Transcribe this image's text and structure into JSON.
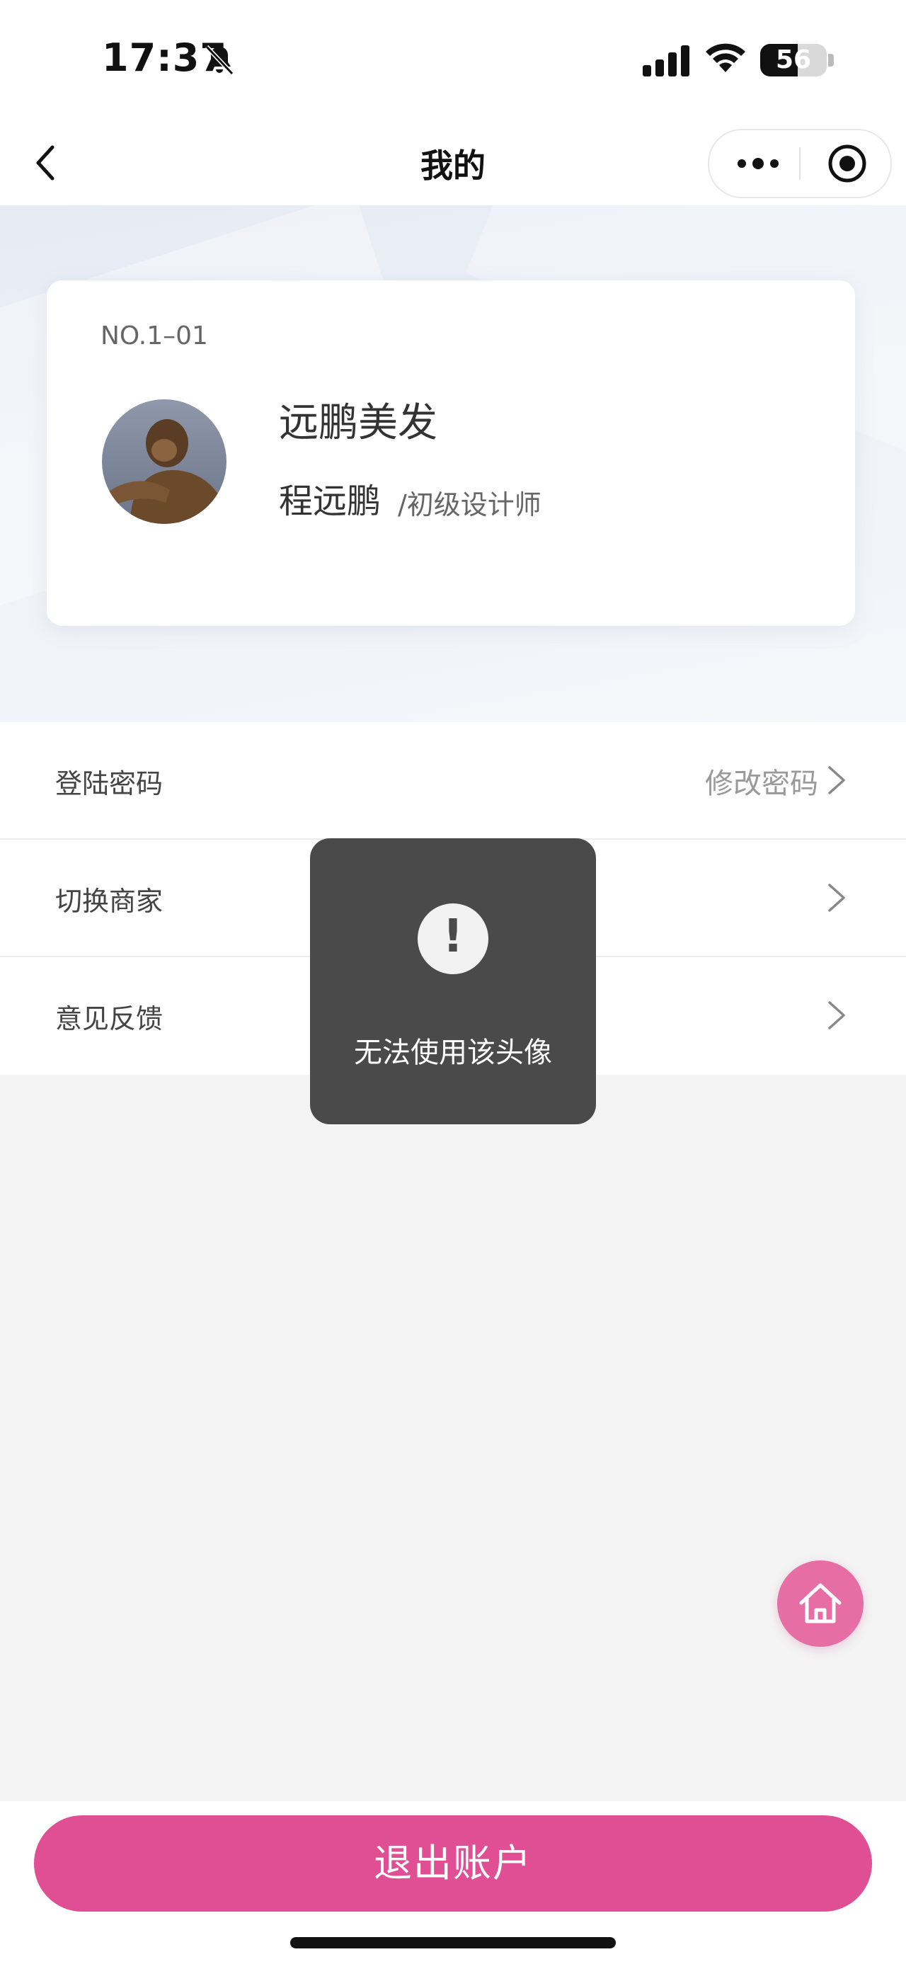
{
  "status_bar": {
    "time": "17:37",
    "battery_level": 56,
    "icons": [
      "bell-muted-icon",
      "cellular-signal-icon",
      "wifi-icon",
      "battery-icon"
    ]
  },
  "nav": {
    "title": "我的",
    "icons": [
      "back-arrow-icon",
      "more-dots-icon",
      "target-icon"
    ]
  },
  "profile": {
    "member_no": "NO.1–01",
    "shop_name": "远鹏美发",
    "user_name": "程远鹏",
    "role": "/初级设计师"
  },
  "menu": {
    "items": [
      {
        "label": "登陆密码",
        "value": "修改密码"
      },
      {
        "label": "切换商家",
        "value": ""
      },
      {
        "label": "意见反馈",
        "value": ""
      }
    ]
  },
  "toast": {
    "icon": "!",
    "message": "无法使用该头像"
  },
  "home_button": {
    "icon": "home-icon"
  },
  "logout": {
    "label": "退出账户"
  },
  "colors": {
    "accent": "#e04e93",
    "home_fab": "#e76ea4",
    "toast_bg": "#4a4a4a"
  }
}
